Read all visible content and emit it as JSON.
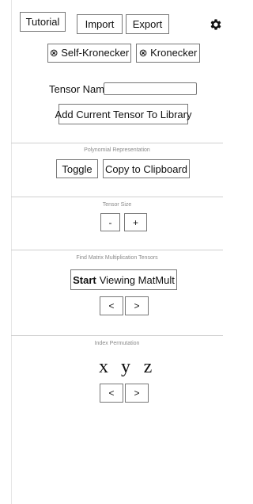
{
  "toolbar": {
    "tutorial_label": "Tutorial",
    "import_label": "Import",
    "export_label": "Export",
    "settings_icon": "gear-icon"
  },
  "kronecker": {
    "self_label": "⊗ Self-Kronecker",
    "kronecker_label": "⊗ Kronecker"
  },
  "tensor_name": {
    "label": "Tensor Name:",
    "value": "",
    "add_button_label": "Add Current Tensor To Library"
  },
  "polynomial": {
    "caption": "Polynomial Representation",
    "toggle_label": "Toggle",
    "copy_label": "Copy to Clipboard"
  },
  "tensor_size": {
    "caption": "Tensor Size",
    "minus_label": "-",
    "plus_label": "+"
  },
  "matmult": {
    "caption": "Find Matrix Multiplication Tensors",
    "start_bold": "Start",
    "start_rest": "Viewing MatMult",
    "prev_label": "<",
    "next_label": ">"
  },
  "index_permutation": {
    "caption": "Index Permutation",
    "letters": [
      "x",
      "y",
      "z"
    ],
    "prev_label": "<",
    "next_label": ">"
  }
}
